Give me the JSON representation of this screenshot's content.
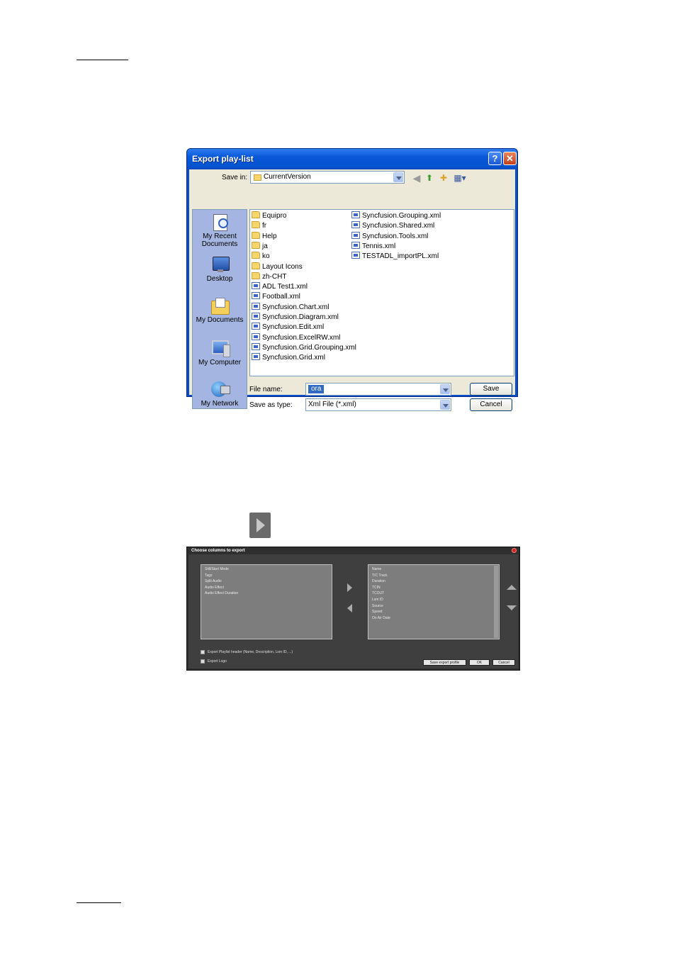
{
  "save_dialog": {
    "title": "Export play-list",
    "save_in_label": "Save in:",
    "save_in_value": "CurrentVersion",
    "places": [
      {
        "label": "My Recent Documents",
        "icon": "recent-documents-icon"
      },
      {
        "label": "Desktop",
        "icon": "desktop-icon"
      },
      {
        "label": "My Documents",
        "icon": "my-documents-icon"
      },
      {
        "label": "My Computer",
        "icon": "my-computer-icon"
      },
      {
        "label": "My Network",
        "icon": "my-network-icon"
      }
    ],
    "files_col1": [
      {
        "name": "Equipro",
        "type": "folder"
      },
      {
        "name": "fr",
        "type": "folder"
      },
      {
        "name": "Help",
        "type": "folder"
      },
      {
        "name": "ja",
        "type": "folder"
      },
      {
        "name": "ko",
        "type": "folder"
      },
      {
        "name": "Layout Icons",
        "type": "folder"
      },
      {
        "name": "zh-CHT",
        "type": "folder"
      },
      {
        "name": "ADL Test1.xml",
        "type": "xml"
      },
      {
        "name": "Football.xml",
        "type": "xml"
      },
      {
        "name": "Syncfusion.Chart.xml",
        "type": "xml"
      },
      {
        "name": "Syncfusion.Diagram.xml",
        "type": "xml"
      },
      {
        "name": "Syncfusion.Edit.xml",
        "type": "xml"
      },
      {
        "name": "Syncfusion.ExcelRW.xml",
        "type": "xml"
      },
      {
        "name": "Syncfusion.Grid.Grouping.xml",
        "type": "xml"
      },
      {
        "name": "Syncfusion.Grid.xml",
        "type": "xml"
      }
    ],
    "files_col2": [
      {
        "name": "Syncfusion.Grouping.xml",
        "type": "xml"
      },
      {
        "name": "Syncfusion.Shared.xml",
        "type": "xml"
      },
      {
        "name": "Syncfusion.Tools.xml",
        "type": "xml"
      },
      {
        "name": "Tennis.xml",
        "type": "xml"
      },
      {
        "name": "TESTADL_importPL.xml",
        "type": "xml"
      }
    ],
    "file_name_label": "File name:",
    "file_name_value": "ora",
    "save_as_type_label": "Save as type:",
    "save_as_type_value": "Xml File (*.xml)",
    "save_button": "Save",
    "cancel_button": "Cancel"
  },
  "export_dialog": {
    "title": "Choose columns to export",
    "available_columns": [
      "Still/Start Mode",
      "Tags",
      "Split Audio",
      "Audio Effect",
      "Audio Effect Duration"
    ],
    "selected_columns": [
      "Name",
      "T/C Track",
      "Duration",
      "TCIN",
      "TCOUT",
      "Lsm ID",
      "Source",
      "Speed",
      "On Air Date"
    ],
    "export_header_label": "Export Playlist header (Name, Description, Lsm ID, ...)",
    "export_logo_label": "Export Logo",
    "save_profile_button": "Save export profile",
    "ok_button": "OK",
    "cancel_button": "Cancel"
  },
  "colors": {
    "xp_title_blue": "#0858d8",
    "dialog_face": "#ece9d8",
    "dark_dialog_bg": "#3f3f3f",
    "list_grey": "#7d7d7d"
  }
}
